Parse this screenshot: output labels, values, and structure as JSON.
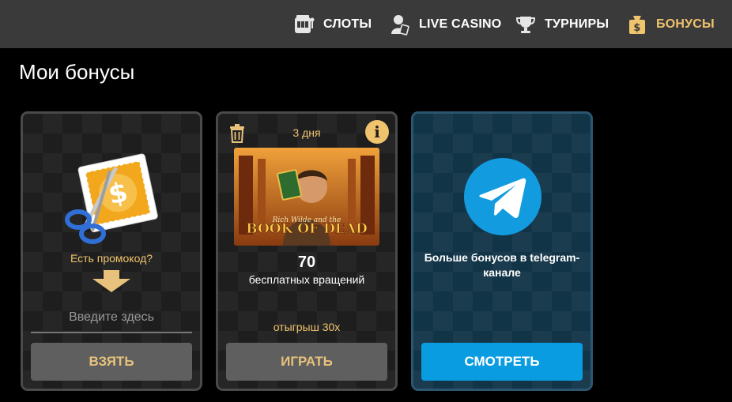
{
  "nav": {
    "items": [
      {
        "label": "СЛОТЫ",
        "icon": "slot-machine-icon"
      },
      {
        "label": "LIVE CASINO",
        "icon": "live-dealer-icon"
      },
      {
        "label": "ТУРНИРЫ",
        "icon": "trophy-icon"
      },
      {
        "label": "БОНУСЫ",
        "icon": "bonus-bag-icon",
        "active": true
      }
    ]
  },
  "page": {
    "title": "Мои бонусы"
  },
  "promo_card": {
    "label": "Есть промокод?",
    "input_placeholder": "Введите здесь",
    "button_label": "ВЗЯТЬ",
    "icon": "coupon-scissors-icon"
  },
  "free_spins_card": {
    "duration": "3 дня",
    "game_title": "BOOK OF DEAD",
    "game_subtitle": "Rich Wilde and the",
    "spins_count": "70",
    "spins_label": "бесплатных вращений",
    "wager": "отыгрыш 30х",
    "button_label": "ИГРАТЬ",
    "icons": [
      "trash-icon",
      "info-icon"
    ]
  },
  "telegram_card": {
    "text": "Больше бонусов в telegram-канале",
    "button_label": "СМОТРЕТЬ",
    "icon": "telegram-icon"
  },
  "colors": {
    "accent_gold": "#f0c36d",
    "topbar": "#3a3a3a",
    "telegram_blue": "#0a9ce0",
    "gray_button": "#5f5f5f"
  }
}
